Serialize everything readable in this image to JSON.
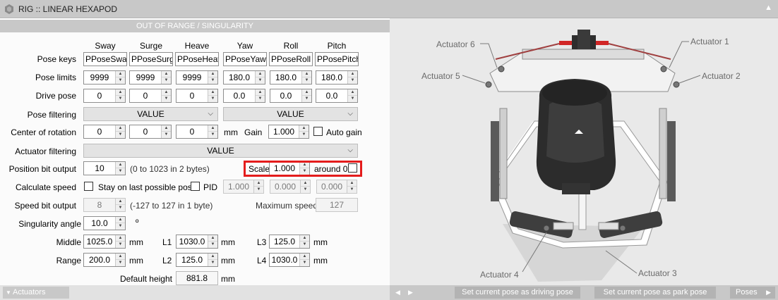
{
  "window": {
    "title": "RIG :: LINEAR HEXAPOD",
    "collapse_icon": "triangle-up-icon"
  },
  "section": {
    "title": "OUT OF RANGE / SINGULARITY"
  },
  "columns": [
    "Sway",
    "Surge",
    "Heave",
    "Yaw",
    "Roll",
    "Pitch"
  ],
  "pose_keys": {
    "label": "Pose keys",
    "values": [
      "PPoseSway",
      "PPoseSurge",
      "PPoseHeave",
      "PPoseYaw",
      "PPoseRoll",
      "PPosePitch"
    ]
  },
  "pose_limits": {
    "label": "Pose limits",
    "values": [
      "9999",
      "9999",
      "9999",
      "180.0",
      "180.0",
      "180.0"
    ]
  },
  "drive_pose": {
    "label": "Drive pose",
    "values": [
      "0",
      "0",
      "0",
      "0.0",
      "0.0",
      "0.0"
    ]
  },
  "pose_filtering": {
    "label": "Pose filtering",
    "translation": "VALUE",
    "rotation": "VALUE"
  },
  "center_of_rotation": {
    "label": "Center of rotation",
    "values": [
      "0",
      "0",
      "0"
    ],
    "unit": "mm",
    "gain_label": "Gain",
    "gain_value": "1.000",
    "auto_gain_label": "Auto gain",
    "auto_gain_checked": false
  },
  "actuator_filtering": {
    "label": "Actuator filtering",
    "value": "VALUE"
  },
  "position_bit_output": {
    "label": "Position bit output",
    "value": "10",
    "range_note": "(0 to 1023 in 2 bytes)",
    "scale_label": "Scale",
    "scale_value": "1.000",
    "around_label": "around 0",
    "around_checked": false
  },
  "calculate_speed": {
    "label": "Calculate speed",
    "checked": false,
    "stay_label": "Stay on last possible pose",
    "stay_checked": false,
    "pid_label": "PID",
    "pid_checked": false,
    "pid_values": [
      "1.000",
      "0.000",
      "0.000"
    ]
  },
  "speed_bit_output": {
    "label": "Speed bit output",
    "value": "8",
    "range_note": "(-127 to 127 in 1 byte)",
    "max_speed_label": "Maximum speed",
    "max_speed_value": "127"
  },
  "singularity_angle": {
    "label": "Singularity angle",
    "value": "10.0",
    "unit": "º"
  },
  "middle": {
    "label": "Middle",
    "value": "1025.0",
    "unit": "mm"
  },
  "range": {
    "label": "Range",
    "value": "200.0",
    "unit": "mm"
  },
  "lengths": [
    {
      "label": "L1",
      "value": "1030.0",
      "unit": "mm"
    },
    {
      "label": "L2",
      "value": "125.0",
      "unit": "mm"
    },
    {
      "label": "L3",
      "value": "125.0",
      "unit": "mm"
    },
    {
      "label": "L4",
      "value": "1030.0",
      "unit": "mm"
    }
  ],
  "default_height": {
    "label": "Default height",
    "value": "881.8",
    "unit": "mm"
  },
  "footer": {
    "actuators_label": "Actuators",
    "set_driving_label": "Set current pose as driving pose",
    "set_park_label": "Set current pose as park pose",
    "poses_label": "Poses",
    "nav_prev_icon": "triangle-left-icon",
    "nav_next_icon": "triangle-right-icon"
  },
  "viewport": {
    "actuators": [
      "Actuator 1",
      "Actuator 2",
      "Actuator 3",
      "Actuator 4",
      "Actuator 5",
      "Actuator 6"
    ]
  },
  "colors": {
    "highlight": "#e41c1c",
    "header": "#c8c8c8"
  }
}
